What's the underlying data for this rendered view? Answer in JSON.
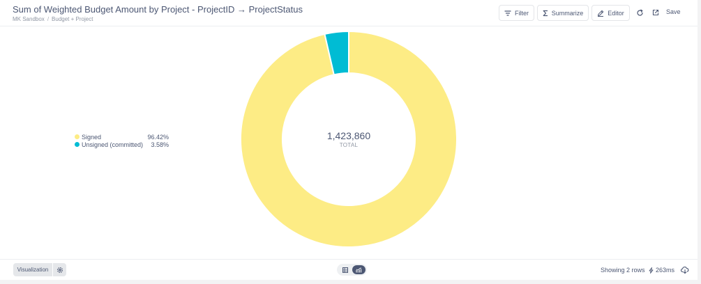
{
  "header": {
    "title": "Sum of Weighted Budget Amount by Project - ProjectID → ProjectStatus",
    "breadcrumb": [
      "MK Sandbox",
      "Budget + Project"
    ],
    "breadcrumb_sep": "/",
    "filter_label": "Filter",
    "summarize_label": "Summarize",
    "editor_label": "Editor",
    "save_label": "Save",
    "icons": [
      "filter-icon",
      "sigma-icon",
      "pencil-icon",
      "refresh-icon",
      "open-external-icon"
    ]
  },
  "chart_data": {
    "type": "pie",
    "categories": [
      "Signed",
      "Unsigned (committed)"
    ],
    "values": [
      96.42,
      3.58
    ],
    "value_unit": "percent",
    "colors": [
      "#fdec85",
      "#00bcd4"
    ],
    "total": 1423860,
    "center_value": "1,423,860",
    "center_label": "TOTAL",
    "legend": {
      "placement": "left",
      "items": [
        {
          "label": "Signed",
          "pct": "96.42%",
          "color": "#fdec85"
        },
        {
          "label": "Unsigned (committed)",
          "pct": "3.58%",
          "color": "#00bcd4"
        }
      ]
    }
  },
  "footer": {
    "visualization_label": "Visualization",
    "rows_text": "Showing 2 rows",
    "timing": "263ms",
    "icons": [
      "gear-icon",
      "table-icon",
      "chart-icon",
      "lightning-icon",
      "download-icon"
    ]
  }
}
